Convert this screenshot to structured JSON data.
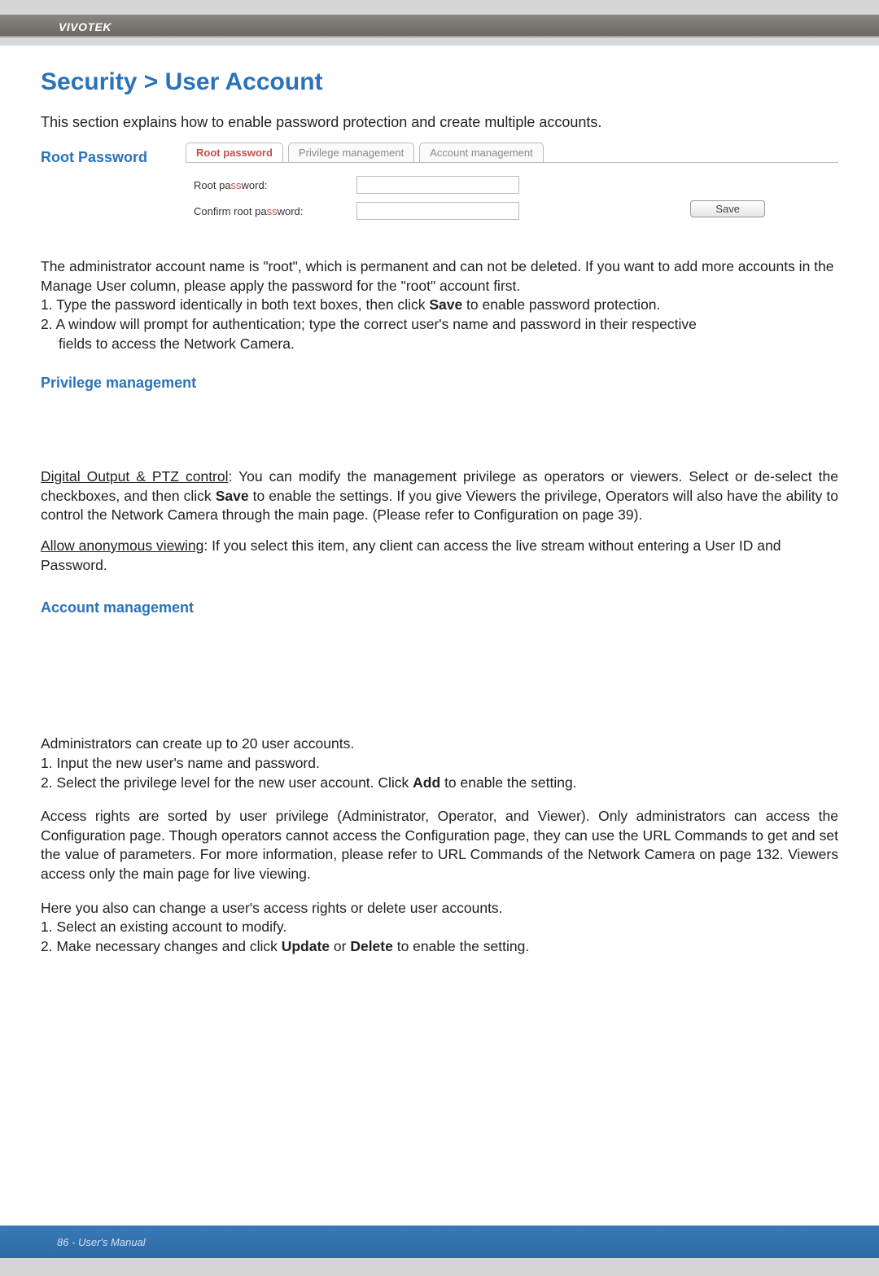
{
  "header": {
    "brand": "VIVOTEK"
  },
  "title": "Security > User Account",
  "intro": "This section explains how to enable password protection and create multiple accounts.",
  "rootPassword": {
    "label": "Root Password",
    "tabs": {
      "root": "Root password",
      "priv": "Privilege management",
      "acct": "Account management"
    },
    "fields": {
      "rootPwPrefix": "Root pa",
      "rootPwMid": "ss",
      "rootPwSuffix": "word:",
      "confirmPrefix": "Confirm root pa",
      "confirmMid": "ss",
      "confirmSuffix": "word:"
    },
    "saveLabel": "Save"
  },
  "adminPara": {
    "line1": "The administrator account name is \"root\", which is permanent and can not be deleted. If you want to add more accounts in the Manage User column, please apply the password for the \"root\" account first.",
    "step1a": "1. Type the password identically in both text boxes, then click ",
    "step1bold": "Save",
    "step1b": " to enable password protection.",
    "step2a": "2. A window will prompt for authentication; type the correct user's name and password in their respective",
    "step2b": "fields to access the Network Camera."
  },
  "privSection": {
    "heading": "Privilege management",
    "p1_underline": "Digital Output & PTZ control",
    "p1_a": ": You can modify the management privilege as operators or viewers. Select or de-select the checkboxes, and then click ",
    "p1_bold": "Save",
    "p1_b": " to enable the settings. If you give Viewers the privilege, Operators will also have the ability to control the Network Camera through the main page. (Please refer to Configuration on page 39).",
    "p2_underline": "Allow anonymous viewing",
    "p2_a": ": If you select this item, any client can access the live stream without entering a User ID and Password."
  },
  "acctSection": {
    "heading": "Account management",
    "p1": "Administrators can create up to 20 user accounts.",
    "s1": "1. Input the new user's name and password.",
    "s2a": "2. Select the privilege level for the new user account. Click ",
    "s2bold": "Add",
    "s2b": " to enable the setting.",
    "p2": "Access rights are sorted by user privilege (Administrator, Operator, and Viewer). Only administrators can access the Configuration page. Though operators cannot access the Configuration page, they can use the URL Commands to get and set the value of parameters. For more information, please refer to URL Commands of the Network Camera on page 132. Viewers access only the main page for live viewing.",
    "p3": "Here you also can change a user's access rights or delete user accounts.",
    "s3": "1. Select an existing account to modify.",
    "s4a": "2. Make necessary changes and click ",
    "s4bold1": "Update",
    "s4mid": " or ",
    "s4bold2": "Delete",
    "s4b": " to enable the setting."
  },
  "footer": {
    "text": "86 - User's Manual"
  }
}
